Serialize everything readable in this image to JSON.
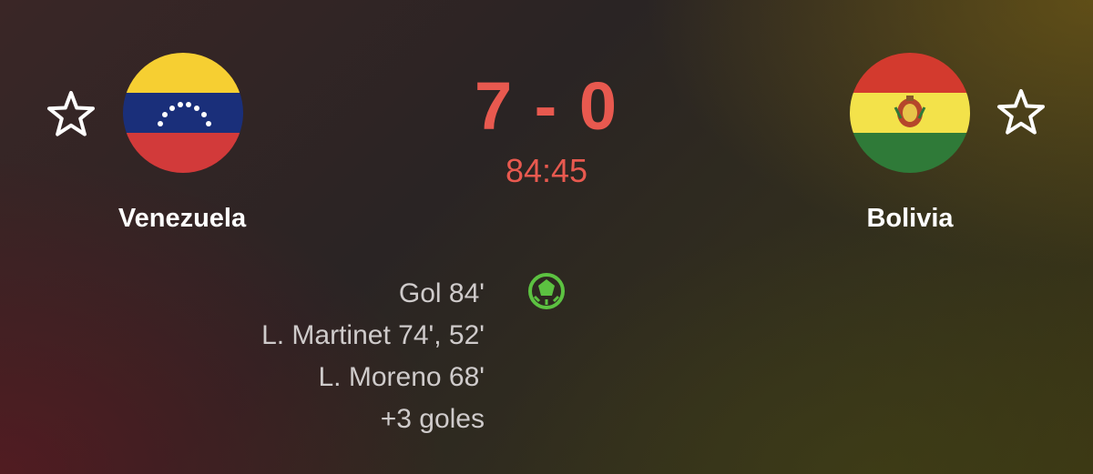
{
  "match": {
    "home": {
      "name": "Venezuela",
      "flag_icon": "venezuela-flag-icon",
      "favorite_icon": "star-outline-icon"
    },
    "away": {
      "name": "Bolivia",
      "flag_icon": "bolivia-flag-icon",
      "favorite_icon": "star-outline-icon"
    },
    "score": "7 - 0",
    "clock": "84:45",
    "events": [
      "Gol 84'",
      "L. Martinet 74', 52'",
      "L. Moreno 68'",
      "+3 goles"
    ],
    "event_icon": "soccer-ball-icon"
  },
  "colors": {
    "score": "#e8594f",
    "event_text": "#cfcbcb",
    "team_text": "#ffffff",
    "ball_icon": "#5cc241"
  }
}
